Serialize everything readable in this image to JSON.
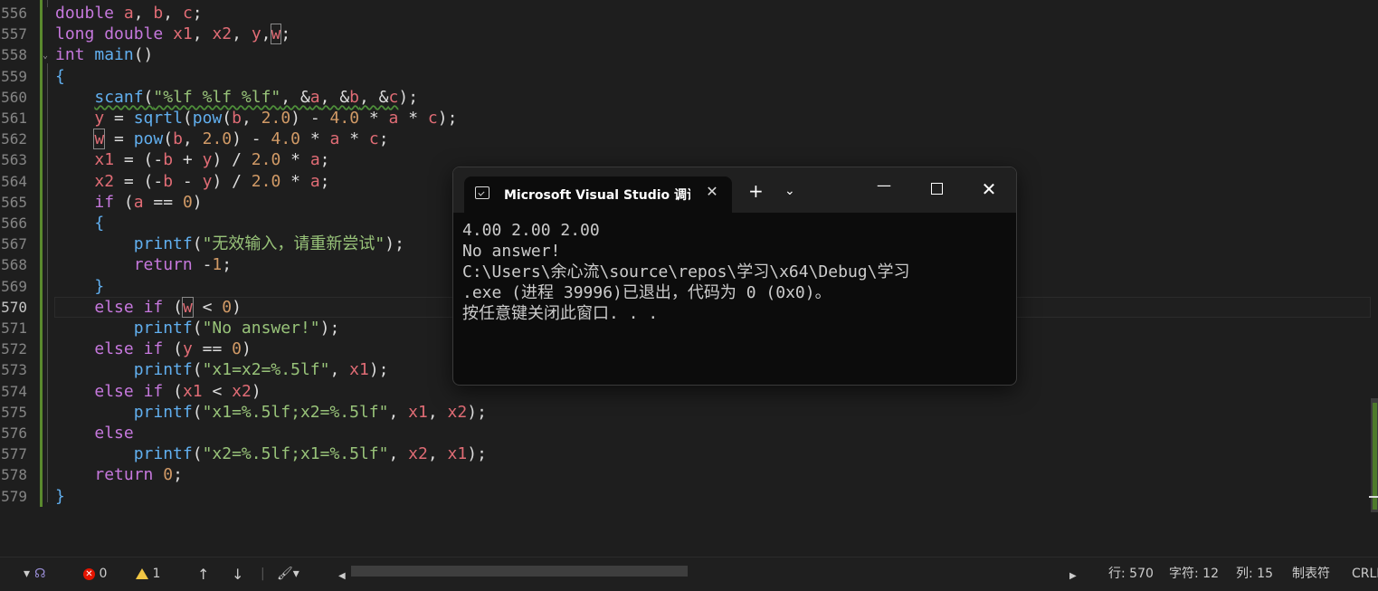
{
  "editor": {
    "lines": [
      {
        "no": "556",
        "tokens": [
          [
            "ty",
            "double"
          ],
          [
            "op",
            " "
          ],
          [
            "var",
            "a"
          ],
          [
            "op",
            ", "
          ],
          [
            "var",
            "b"
          ],
          [
            "op",
            ", "
          ],
          [
            "var",
            "c"
          ],
          [
            "op",
            ";"
          ]
        ]
      },
      {
        "no": "557",
        "tokens": [
          [
            "ty",
            "long"
          ],
          [
            "op",
            " "
          ],
          [
            "ty",
            "double"
          ],
          [
            "op",
            " "
          ],
          [
            "var",
            "x1"
          ],
          [
            "op",
            ", "
          ],
          [
            "var",
            "x2"
          ],
          [
            "op",
            ", "
          ],
          [
            "var",
            "y"
          ],
          [
            "op",
            ","
          ],
          [
            "varbox",
            "w"
          ],
          [
            "op",
            ";"
          ]
        ]
      },
      {
        "no": "558",
        "tokens": [
          [
            "ty",
            "int"
          ],
          [
            "op",
            " "
          ],
          [
            "fn",
            "main"
          ],
          [
            "op",
            "()"
          ]
        ]
      },
      {
        "no": "559",
        "tokens": [
          [
            "brace",
            "{"
          ]
        ]
      },
      {
        "no": "560",
        "tokens": [
          [
            "op",
            "    "
          ],
          [
            "fnsq",
            "scanf"
          ],
          [
            "sq",
            "("
          ],
          [
            "strsq",
            "\"%lf %lf %lf\""
          ],
          [
            "sq",
            ", &"
          ],
          [
            "varsq",
            "a"
          ],
          [
            "sq",
            ", &"
          ],
          [
            "varsq",
            "b"
          ],
          [
            "sq",
            ", &"
          ],
          [
            "varsq",
            "c"
          ],
          [
            "op",
            ");"
          ]
        ]
      },
      {
        "no": "561",
        "tokens": [
          [
            "op",
            "    "
          ],
          [
            "var",
            "y"
          ],
          [
            "op",
            " = "
          ],
          [
            "fn",
            "sqrtl"
          ],
          [
            "op",
            "("
          ],
          [
            "fn",
            "pow"
          ],
          [
            "op",
            "("
          ],
          [
            "var",
            "b"
          ],
          [
            "op",
            ", "
          ],
          [
            "num",
            "2.0"
          ],
          [
            "op",
            ") - "
          ],
          [
            "num",
            "4.0"
          ],
          [
            "op",
            " * "
          ],
          [
            "var",
            "a"
          ],
          [
            "op",
            " * "
          ],
          [
            "var",
            "c"
          ],
          [
            "op",
            ");"
          ]
        ]
      },
      {
        "no": "562",
        "tokens": [
          [
            "op",
            "    "
          ],
          [
            "varbox",
            "w"
          ],
          [
            "op",
            " = "
          ],
          [
            "fn",
            "pow"
          ],
          [
            "op",
            "("
          ],
          [
            "var",
            "b"
          ],
          [
            "op",
            ", "
          ],
          [
            "num",
            "2.0"
          ],
          [
            "op",
            ") - "
          ],
          [
            "num",
            "4.0"
          ],
          [
            "op",
            " * "
          ],
          [
            "var",
            "a"
          ],
          [
            "op",
            " * "
          ],
          [
            "var",
            "c"
          ],
          [
            "op",
            ";"
          ]
        ]
      },
      {
        "no": "563",
        "tokens": [
          [
            "op",
            "    "
          ],
          [
            "var",
            "x1"
          ],
          [
            "op",
            " = (-"
          ],
          [
            "var",
            "b"
          ],
          [
            "op",
            " + "
          ],
          [
            "var",
            "y"
          ],
          [
            "op",
            ") / "
          ],
          [
            "num",
            "2.0"
          ],
          [
            "op",
            " * "
          ],
          [
            "var",
            "a"
          ],
          [
            "op",
            ";"
          ]
        ]
      },
      {
        "no": "564",
        "tokens": [
          [
            "op",
            "    "
          ],
          [
            "var",
            "x2"
          ],
          [
            "op",
            " = (-"
          ],
          [
            "var",
            "b"
          ],
          [
            "op",
            " - "
          ],
          [
            "var",
            "y"
          ],
          [
            "op",
            ") / "
          ],
          [
            "num",
            "2.0"
          ],
          [
            "op",
            " * "
          ],
          [
            "var",
            "a"
          ],
          [
            "op",
            ";"
          ]
        ]
      },
      {
        "no": "565",
        "tokens": [
          [
            "op",
            "    "
          ],
          [
            "kw",
            "if"
          ],
          [
            "op",
            " ("
          ],
          [
            "var",
            "a"
          ],
          [
            "op",
            " == "
          ],
          [
            "num",
            "0"
          ],
          [
            "op",
            ")"
          ]
        ]
      },
      {
        "no": "566",
        "tokens": [
          [
            "op",
            "    "
          ],
          [
            "brace",
            "{"
          ]
        ]
      },
      {
        "no": "567",
        "tokens": [
          [
            "op",
            "        "
          ],
          [
            "fn",
            "printf"
          ],
          [
            "op",
            "("
          ],
          [
            "str",
            "\"无效输入，请重新尝试\""
          ],
          [
            "op",
            ");"
          ]
        ]
      },
      {
        "no": "568",
        "tokens": [
          [
            "op",
            "        "
          ],
          [
            "kw",
            "return"
          ],
          [
            "op",
            " -"
          ],
          [
            "num",
            "1"
          ],
          [
            "op",
            ";"
          ]
        ]
      },
      {
        "no": "569",
        "tokens": [
          [
            "op",
            "    "
          ],
          [
            "brace",
            "}"
          ]
        ]
      },
      {
        "no": "570",
        "tokens": [
          [
            "op",
            "    "
          ],
          [
            "kw",
            "else"
          ],
          [
            "op",
            " "
          ],
          [
            "kw",
            "if"
          ],
          [
            "op",
            " ("
          ],
          [
            "varbox",
            "w"
          ],
          [
            "op",
            " < "
          ],
          [
            "num",
            "0"
          ],
          [
            "op",
            ")"
          ]
        ]
      },
      {
        "no": "571",
        "tokens": [
          [
            "op",
            "        "
          ],
          [
            "fn",
            "printf"
          ],
          [
            "op",
            "("
          ],
          [
            "str",
            "\"No answer!\""
          ],
          [
            "op",
            ");"
          ]
        ]
      },
      {
        "no": "572",
        "tokens": [
          [
            "op",
            "    "
          ],
          [
            "kw",
            "else"
          ],
          [
            "op",
            " "
          ],
          [
            "kw",
            "if"
          ],
          [
            "op",
            " ("
          ],
          [
            "var",
            "y"
          ],
          [
            "op",
            " == "
          ],
          [
            "num",
            "0"
          ],
          [
            "op",
            ")"
          ]
        ]
      },
      {
        "no": "573",
        "tokens": [
          [
            "op",
            "        "
          ],
          [
            "fn",
            "printf"
          ],
          [
            "op",
            "("
          ],
          [
            "str",
            "\"x1=x2=%.5lf\""
          ],
          [
            "op",
            ", "
          ],
          [
            "var",
            "x1"
          ],
          [
            "op",
            ");"
          ]
        ]
      },
      {
        "no": "574",
        "tokens": [
          [
            "op",
            "    "
          ],
          [
            "kw",
            "else"
          ],
          [
            "op",
            " "
          ],
          [
            "kw",
            "if"
          ],
          [
            "op",
            " ("
          ],
          [
            "var",
            "x1"
          ],
          [
            "op",
            " < "
          ],
          [
            "var",
            "x2"
          ],
          [
            "op",
            ")"
          ]
        ]
      },
      {
        "no": "575",
        "tokens": [
          [
            "op",
            "        "
          ],
          [
            "fn",
            "printf"
          ],
          [
            "op",
            "("
          ],
          [
            "str",
            "\"x1=%.5lf;x2=%.5lf\""
          ],
          [
            "op",
            ", "
          ],
          [
            "var",
            "x1"
          ],
          [
            "op",
            ", "
          ],
          [
            "var",
            "x2"
          ],
          [
            "op",
            ");"
          ]
        ]
      },
      {
        "no": "576",
        "tokens": [
          [
            "op",
            "    "
          ],
          [
            "kw",
            "else"
          ]
        ]
      },
      {
        "no": "577",
        "tokens": [
          [
            "op",
            "        "
          ],
          [
            "fn",
            "printf"
          ],
          [
            "op",
            "("
          ],
          [
            "str",
            "\"x2=%.5lf;x1=%.5lf\""
          ],
          [
            "op",
            ", "
          ],
          [
            "var",
            "x2"
          ],
          [
            "op",
            ", "
          ],
          [
            "var",
            "x1"
          ],
          [
            "op",
            ");"
          ]
        ]
      },
      {
        "no": "578",
        "tokens": [
          [
            "op",
            "    "
          ],
          [
            "kw",
            "return"
          ],
          [
            "op",
            " "
          ],
          [
            "num",
            "0"
          ],
          [
            "op",
            ";"
          ]
        ]
      },
      {
        "no": "579",
        "tokens": [
          [
            "brace",
            "}"
          ]
        ]
      }
    ],
    "current_line": "570"
  },
  "console": {
    "tab_title": "Microsoft Visual Studio 调试控制台",
    "new_tab_glyph": "+",
    "dropdown_glyph": "⌄",
    "close_glyph": "✕",
    "minimize_glyph": "—",
    "window_close_glyph": "✕",
    "output": "4.00 2.00 2.00\nNo answer!\nC:\\Users\\余心流\\source\\repos\\学习\\x64\\Debug\\学习\n.exe (进程 39996)已退出，代码为 0 (0x0)。\n按任意键关闭此窗口. . ."
  },
  "statusbar": {
    "errors": "0",
    "warnings": "1",
    "line": "行: 570",
    "char": "字符: 12",
    "col": "列: 15",
    "indent": "制表符",
    "eol": "CRLF"
  },
  "colors": {
    "background": "#1e1e1e",
    "keyword": "#c678dd",
    "function": "#61afef",
    "variable": "#e06c75",
    "string": "#98c379",
    "number": "#d19a66",
    "git_changed": "#5a8a2e"
  }
}
